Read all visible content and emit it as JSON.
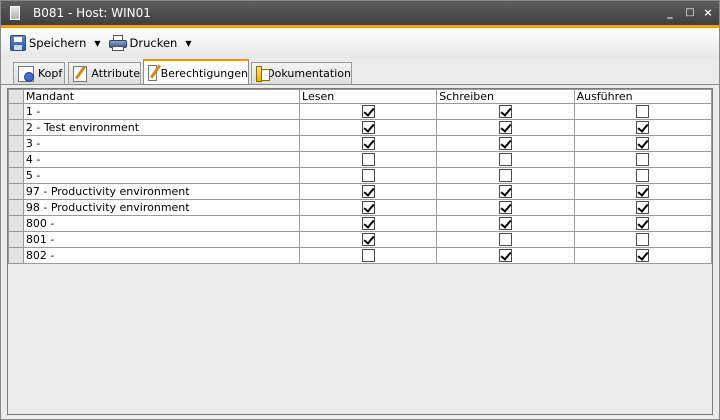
{
  "window": {
    "title": "B081 - Host: WIN01",
    "controls": [
      "_",
      "□",
      "×"
    ]
  },
  "toolbar": {
    "save_label": "Speichern",
    "print_label": "Drucken"
  },
  "tabs": [
    {
      "label": "Kopf",
      "icon": "kopf-icon",
      "active": false
    },
    {
      "label": "Attribute",
      "icon": "attribute-icon",
      "active": false
    },
    {
      "label": "Berechtigungen",
      "icon": "berechtigungen-icon",
      "active": true
    },
    {
      "label": "Dokumentation",
      "icon": "dokumentation-icon",
      "active": false
    }
  ],
  "grid": {
    "columns": [
      "Mandant",
      "Lesen",
      "Schreiben",
      "Ausführen"
    ],
    "rows": [
      {
        "mandant": "1 -",
        "lesen": true,
        "schreiben": true,
        "ausfuehren": false
      },
      {
        "mandant": "2 - Test environment",
        "lesen": true,
        "schreiben": true,
        "ausfuehren": true
      },
      {
        "mandant": "3 -",
        "lesen": true,
        "schreiben": true,
        "ausfuehren": true
      },
      {
        "mandant": "4 -",
        "lesen": false,
        "schreiben": false,
        "ausfuehren": false
      },
      {
        "mandant": "5 -",
        "lesen": false,
        "schreiben": false,
        "ausfuehren": false
      },
      {
        "mandant": "97 - Productivity environment",
        "lesen": true,
        "schreiben": true,
        "ausfuehren": true
      },
      {
        "mandant": "98 - Productivity environment",
        "lesen": true,
        "schreiben": true,
        "ausfuehren": true
      },
      {
        "mandant": "800 -",
        "lesen": true,
        "schreiben": true,
        "ausfuehren": true
      },
      {
        "mandant": "801 -",
        "lesen": true,
        "schreiben": false,
        "ausfuehren": false
      },
      {
        "mandant": "802 -",
        "lesen": false,
        "schreiben": true,
        "ausfuehren": true
      }
    ]
  },
  "colors": {
    "accent": "#f0a000",
    "titlebar": "#4a4a4a"
  }
}
